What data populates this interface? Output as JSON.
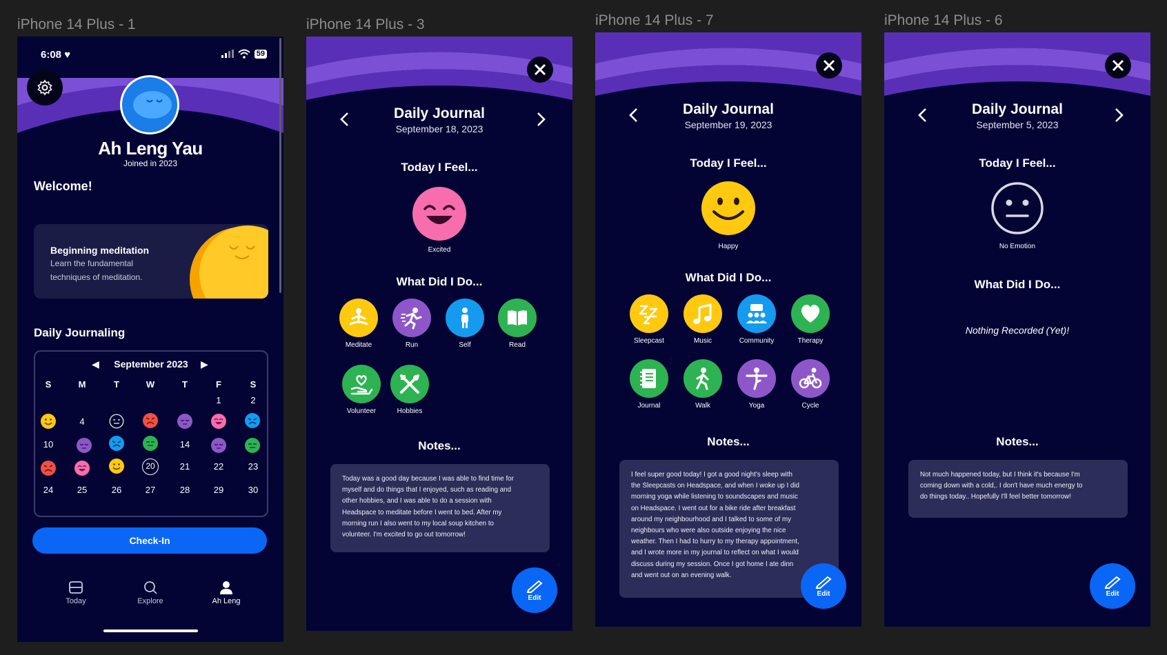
{
  "frames": [
    "iPhone 14 Plus - 1",
    "iPhone 14 Plus - 3",
    "iPhone 14 Plus - 7",
    "iPhone 14 Plus - 6"
  ],
  "profile": {
    "time": "6:08",
    "battery": "59",
    "name": "Ah Leng Yau",
    "joined": "Joined in 2023",
    "welcome": "Welcome!",
    "card_title": "Beginning meditation",
    "card_desc_1": "Learn the fundamental",
    "card_desc_2": "techniques of meditation.",
    "journal_heading": "Daily Journaling",
    "month": "September 2023",
    "weekdays": [
      "S",
      "M",
      "T",
      "W",
      "T",
      "F",
      "S"
    ],
    "days": {
      "d1": "1",
      "d2": "2",
      "d4": "4",
      "d10": "10",
      "d14": "14",
      "d20": "20",
      "d21": "21",
      "d22": "22",
      "d23": "23",
      "d24": "24",
      "d25": "25",
      "d26": "26",
      "d27": "27",
      "d28": "28",
      "d29": "29",
      "d30": "30"
    },
    "checkin": "Check-In",
    "tabs": [
      "Today",
      "Explore",
      "Ah Leng"
    ]
  },
  "journal_common": {
    "title": "Daily Journal",
    "feel": "Today I Feel...",
    "did": "What Did I Do...",
    "notes": "Notes...",
    "edit": "Edit"
  },
  "j1": {
    "date": "September 18, 2023",
    "mood": "Excited",
    "activities": [
      "Meditate",
      "Run",
      "Self",
      "Read",
      "Volunteer",
      "Hobbies"
    ],
    "note_lines": [
      "Today was a good day because I was able to find time for",
      "myself and do things that I enjoyed, such as reading and",
      "other hobbies, and I was able to do a session with",
      "Headspace to meditate before I went to bed. After my",
      "morning run I also went to my local soup kitchen to",
      "volunteer. I'm excited to go out tomorrow!"
    ]
  },
  "j2": {
    "date": "September 19, 2023",
    "mood": "Happy",
    "activities": [
      "Sleepcast",
      "Music",
      "Community",
      "Therapy",
      "Journal",
      "Walk",
      "Yoga",
      "Cycle"
    ],
    "note_lines": [
      "I feel super good today! I got a good night's sleep with",
      "the Sleepcasts on Headspace, and when I woke up I did",
      "morning yoga while listening to soundscapes and music",
      "on Headspace. I went out for a bike ride after breakfast",
      "around my neighbourhood and I talked to some of my",
      "neighbours who were also outside enjoying the nice",
      "weather. Then I had to hurry to my therapy appointment,",
      "and I wrote more in my journal to reflect on what I would",
      "discuss during my session. Once I got home I ate dinn",
      "and went out on an evening walk."
    ]
  },
  "j3": {
    "date": "September 5, 2023",
    "mood": "No Emotion",
    "nothing": "Nothing Recorded (Yet)!",
    "note_lines": [
      "Not much happened today, but I think it's because I'm",
      "coming down with a cold,. I don't have much energy to",
      "do things today.. Hopefully I'll feel better tomorrow!"
    ]
  },
  "colors": {
    "bg": "#030434",
    "wave_light": "#7b4fd6",
    "wave_dark": "#5a2fb8",
    "accent_blue": "#0a66f5",
    "yellow": "#ffc90f",
    "purple": "#8e57c9",
    "green": "#2db352",
    "blue": "#149bef",
    "pink": "#f76dae"
  }
}
